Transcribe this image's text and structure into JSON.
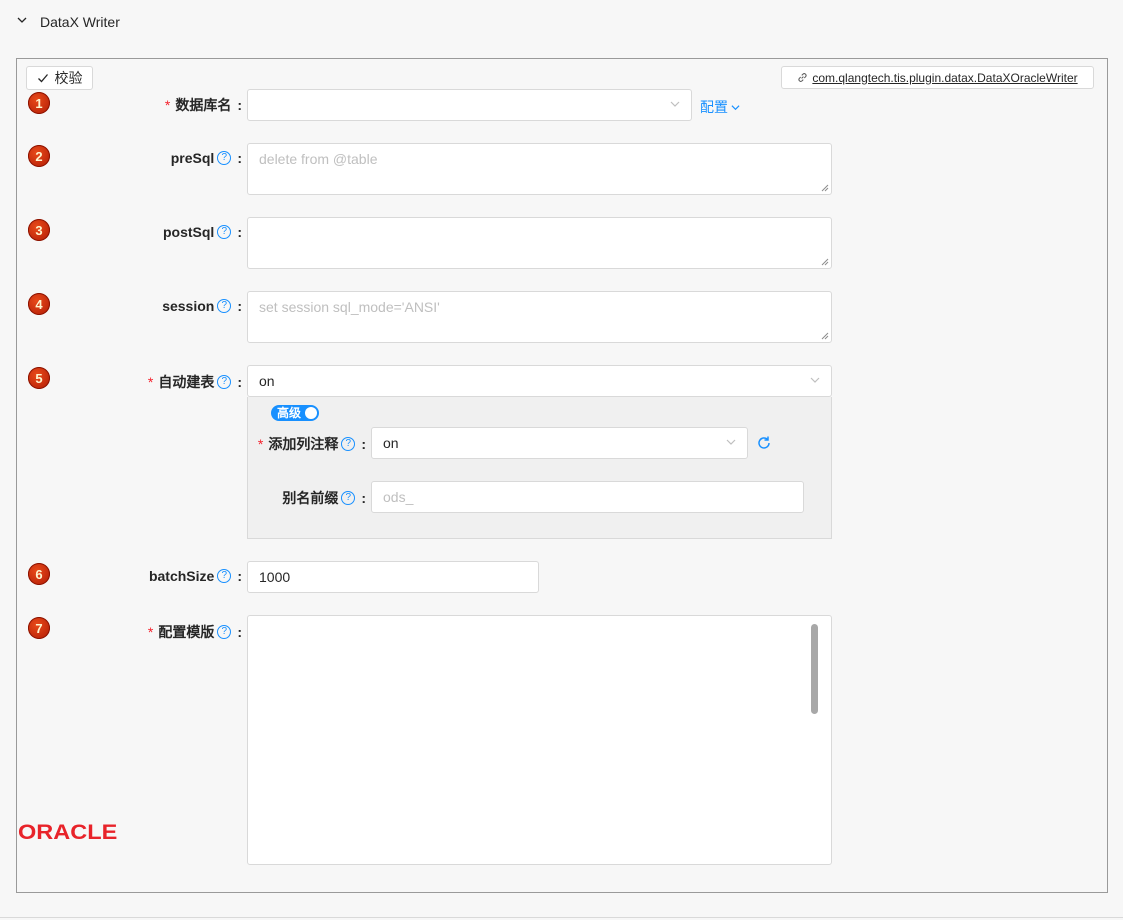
{
  "section": {
    "title": "DataX Writer",
    "chevron_icon": "chevron-down-icon"
  },
  "toolbar": {
    "verify_label": "校验",
    "plugin_label": "com.qlangtech.tis.plugin.datax.DataXOracleWriter"
  },
  "fields": {
    "db": {
      "badge": "1",
      "label": "数据库名",
      "value": "",
      "config_link": "配置"
    },
    "presql": {
      "badge": "2",
      "label": "preSql",
      "placeholder": "delete from @table"
    },
    "postsql": {
      "badge": "3",
      "label": "postSql",
      "placeholder": ""
    },
    "session": {
      "badge": "4",
      "label": "session",
      "placeholder": "set session sql_mode='ANSI'"
    },
    "autocreate": {
      "badge": "5",
      "label": "自动建表",
      "value": "on",
      "advanced_toggle": "高级",
      "add_comment": {
        "label": "添加列注释",
        "value": "on"
      },
      "alias_prefix": {
        "label": "别名前缀",
        "placeholder": "ods_"
      }
    },
    "batchsize": {
      "badge": "6",
      "label": "batchSize",
      "value": "1000"
    },
    "template": {
      "badge": "7",
      "label": "配置模版",
      "value": ""
    }
  },
  "logo": {
    "text": "ORACLE",
    "color": "#e8232a"
  },
  "colors": {
    "accent": "#1890ff",
    "required": "#f5222d",
    "badge": "#c52a0a"
  }
}
